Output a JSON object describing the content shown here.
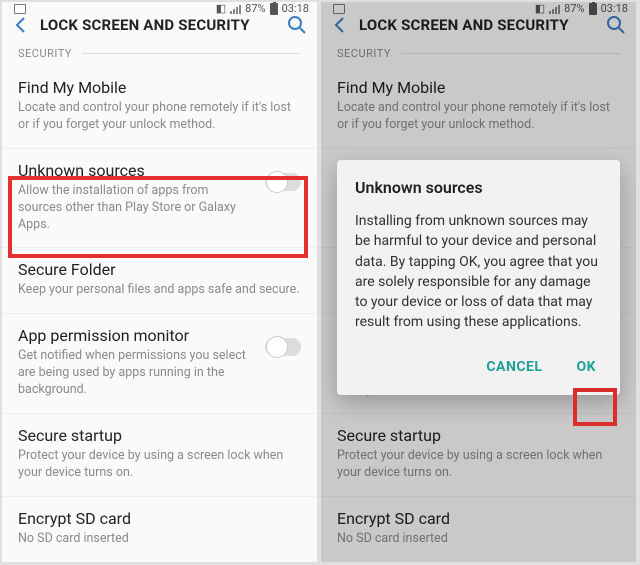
{
  "status": {
    "battery_pct": "87%",
    "time": "03:18"
  },
  "appbar": {
    "title": "LOCK SCREEN AND SECURITY"
  },
  "section": {
    "label": "SECURITY"
  },
  "items": {
    "find_my_mobile": {
      "title": "Find My Mobile",
      "sub": "Locate and control your phone remotely if it's lost or if you forget your unlock method."
    },
    "unknown_sources": {
      "title": "Unknown sources",
      "sub": "Allow the installation of apps from sources other than Play Store or Galaxy Apps."
    },
    "secure_folder": {
      "title": "Secure Folder",
      "sub": "Keep your personal files and apps safe and secure."
    },
    "app_permission": {
      "title": "App permission monitor",
      "sub": "Get notified when permissions you select are being used by apps running in the background."
    },
    "secure_startup": {
      "title": "Secure startup",
      "sub": "Protect your device by using a screen lock when your device turns on."
    },
    "encrypt_sd": {
      "title": "Encrypt SD card",
      "sub": "No SD card inserted"
    }
  },
  "dialog": {
    "title": "Unknown sources",
    "body": "Installing from unknown sources may be harmful to your device and personal data. By tapping OK, you agree that you are solely responsible for any damage to your device or loss of data that may result from using these applications.",
    "cancel": "CANCEL",
    "ok": "OK"
  }
}
